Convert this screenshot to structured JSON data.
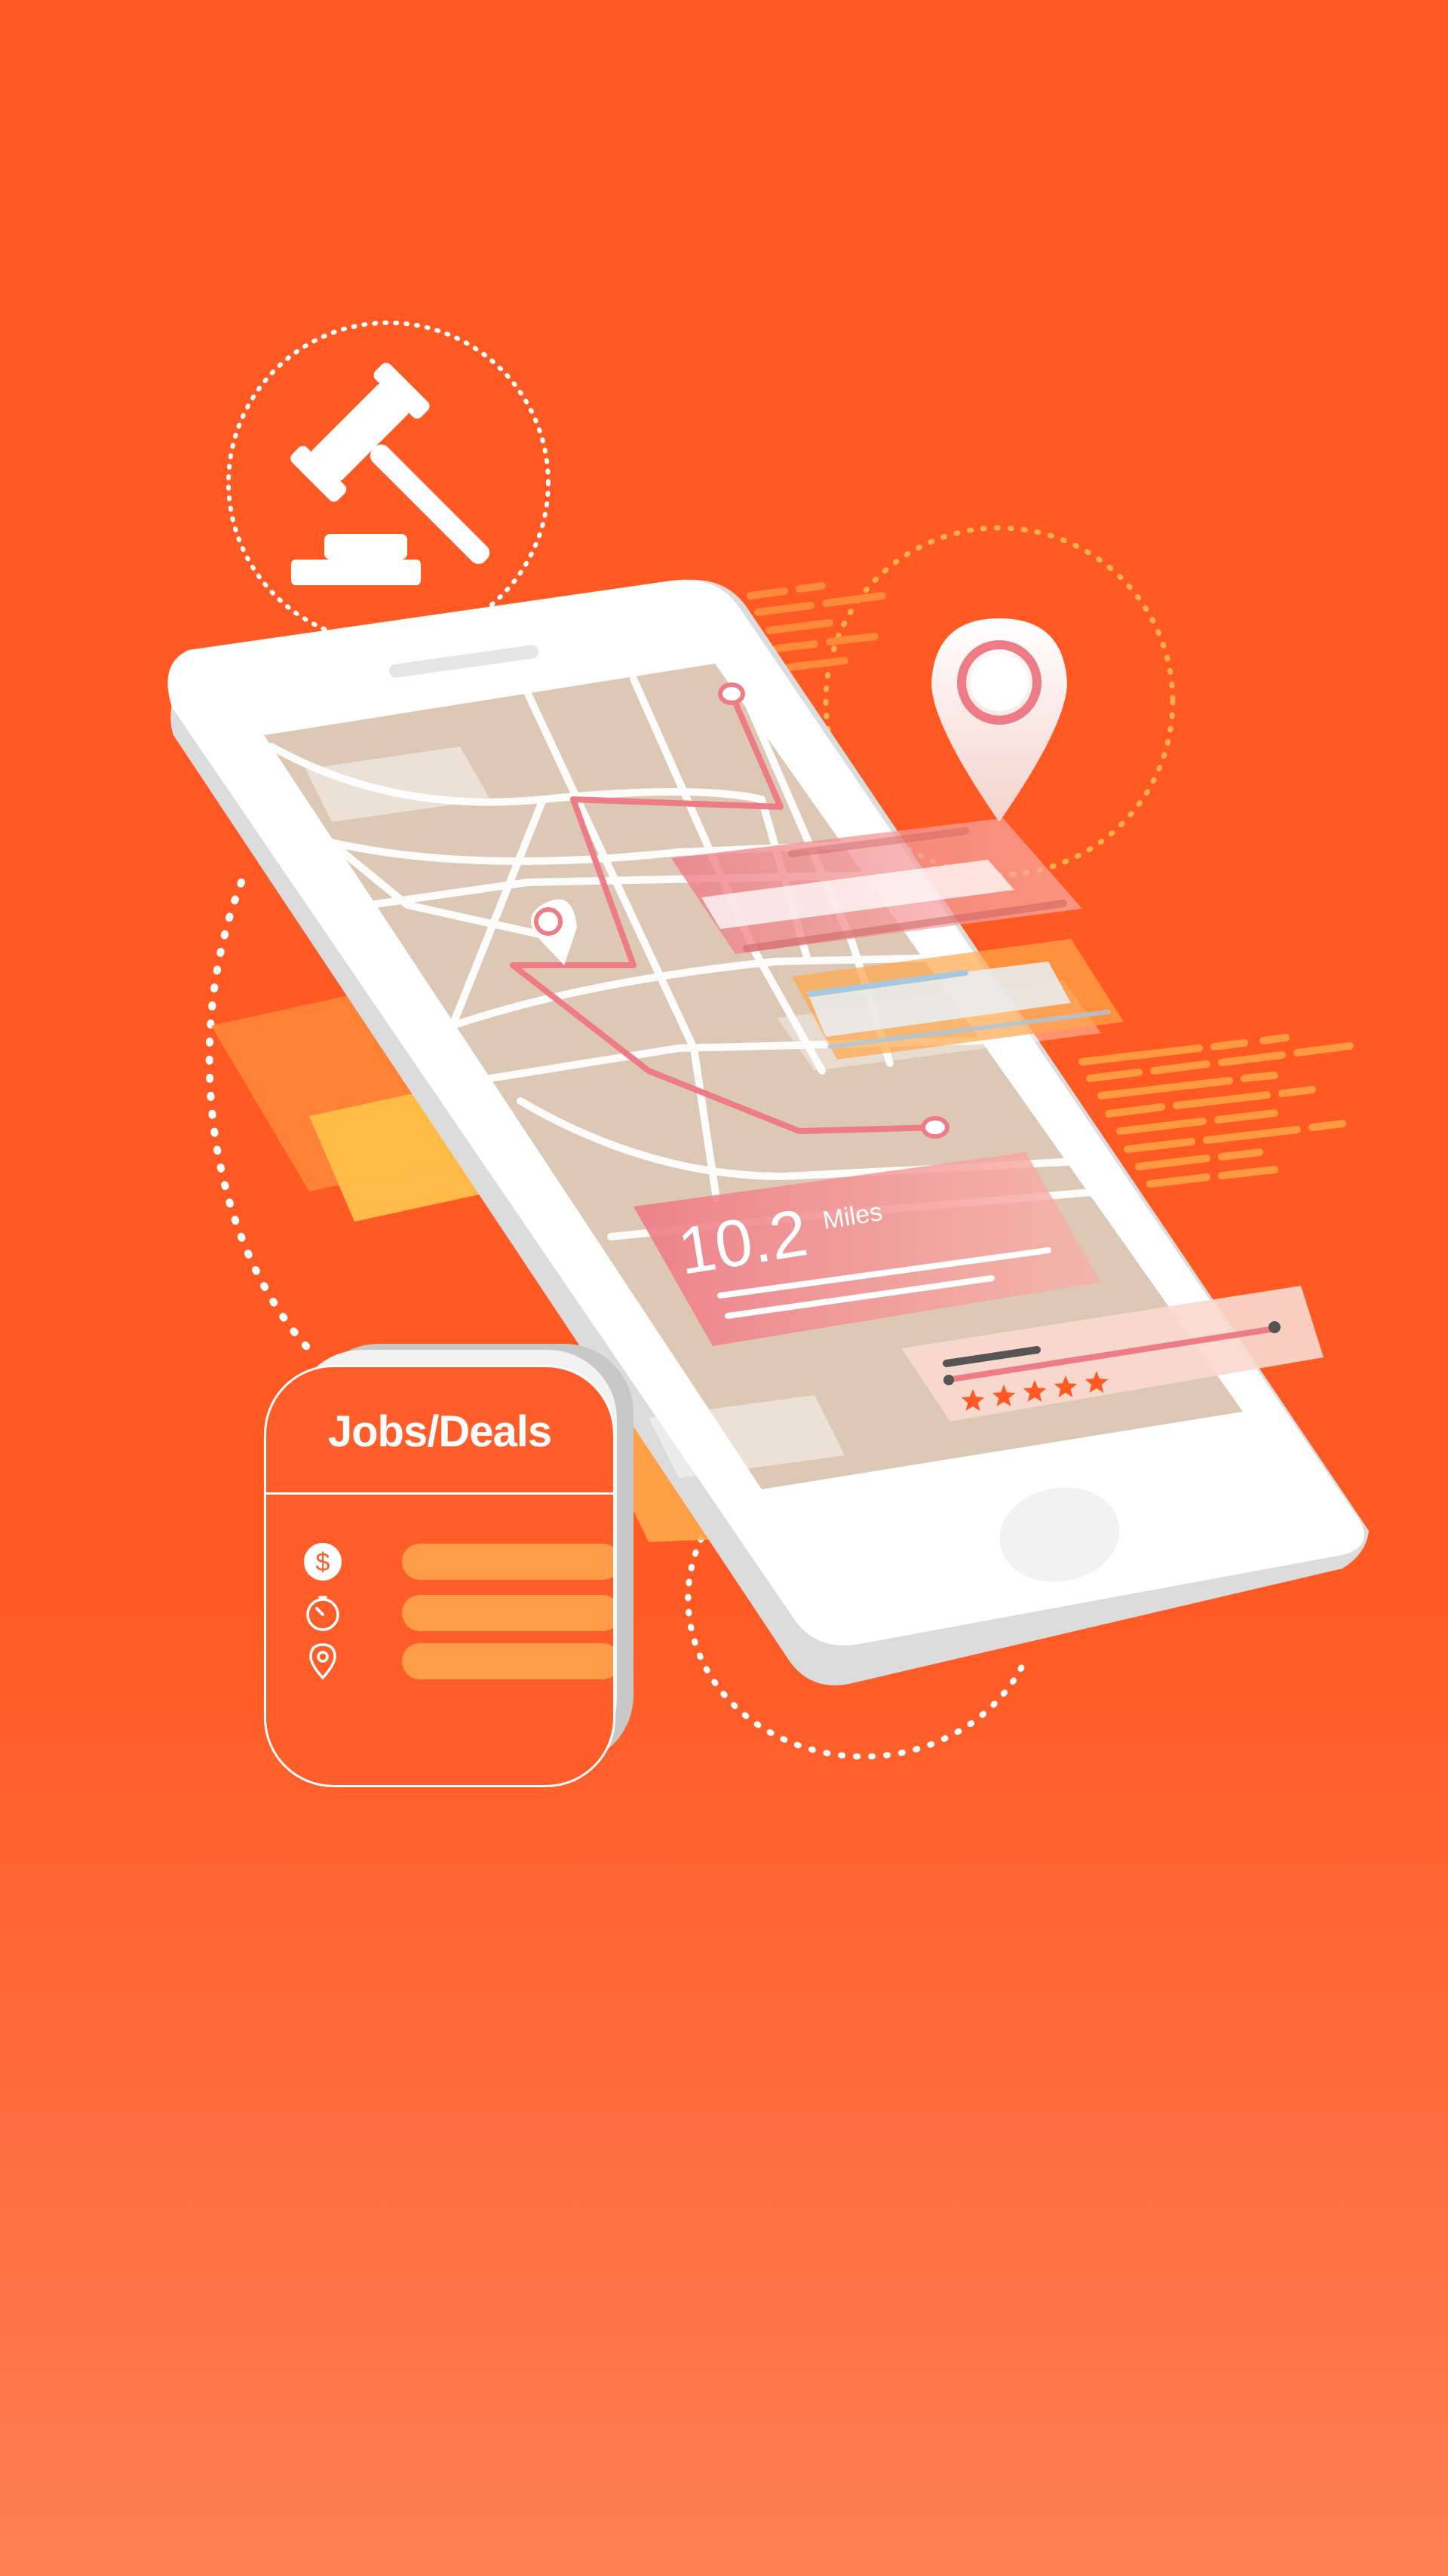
{
  "distance_card": {
    "value": "10.2",
    "unit": "Miles"
  },
  "jobs_card": {
    "title": "Jobs/Deals",
    "rows": [
      {
        "icon": "dollar-icon"
      },
      {
        "icon": "timer-icon"
      },
      {
        "icon": "location-pin-icon"
      }
    ]
  },
  "rating": {
    "stars": 5,
    "max": 5
  },
  "icons": {
    "top_left": "gavel-icon",
    "top_right": "location-pin-icon"
  },
  "colors": {
    "background": "#FF5A24",
    "accent_orange": "#FF9C47",
    "route_pink": "#F07A8A",
    "white": "#FFFFFF"
  }
}
